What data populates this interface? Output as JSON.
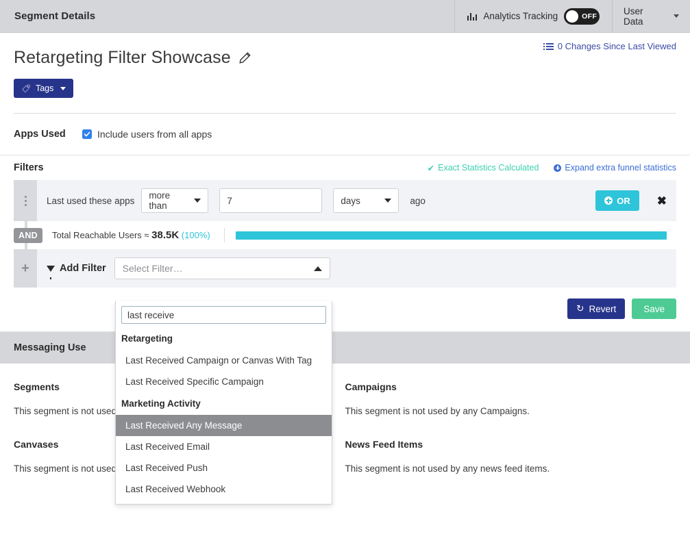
{
  "topbar": {
    "title": "Segment Details",
    "analytics_label": "Analytics Tracking",
    "toggle_state": "OFF",
    "user_data_label": "User Data"
  },
  "title_block": {
    "page_title": "Retargeting Filter Showcase",
    "changes_link": "0 Changes Since Last Viewed",
    "tags_button": "Tags"
  },
  "apps": {
    "label": "Apps Used",
    "checkbox_label": "Include users from all apps",
    "checked": true
  },
  "filters": {
    "title": "Filters",
    "exact_stats": "Exact Statistics Calculated",
    "expand_link": "Expand extra funnel statistics",
    "row": {
      "label": "Last used these apps",
      "operator": "more than",
      "value": "7",
      "unit": "days",
      "suffix": "ago",
      "or_button": "OR",
      "remove": "✖"
    },
    "connector": "AND",
    "stats": {
      "text_prefix": "Total Reachable Users ≈ ",
      "count": "38.5K",
      "percent": "(100%)",
      "bar_fill_percent": 100
    },
    "add_filter": {
      "label": "Add Filter",
      "select_placeholder": "Select Filter…"
    }
  },
  "dropdown": {
    "search_value": "last receive",
    "groups": [
      {
        "name": "Retargeting",
        "items": [
          {
            "label": "Last Received Campaign or Canvas With Tag",
            "highlighted": false
          },
          {
            "label": "Last Received Specific Campaign",
            "highlighted": false
          }
        ]
      },
      {
        "name": "Marketing Activity",
        "items": [
          {
            "label": "Last Received Any Message",
            "highlighted": true
          },
          {
            "label": "Last Received Email",
            "highlighted": false
          },
          {
            "label": "Last Received Push",
            "highlighted": false
          },
          {
            "label": "Last Received Webhook",
            "highlighted": false
          }
        ]
      }
    ]
  },
  "actions": {
    "revert": "Revert",
    "save": "Save"
  },
  "messaging_use": {
    "heading": "Messaging Use",
    "cells": [
      {
        "title": "Segments",
        "text": "This segment is not used by any Segments."
      },
      {
        "title": "Campaigns",
        "text": "This segment is not used by any Campaigns."
      },
      {
        "title": "Canvases",
        "text": "This segment is not used by any Canvases."
      },
      {
        "title": "News Feed Items",
        "text": "This segment is not used by any news feed items."
      }
    ]
  },
  "colors": {
    "navy": "#27348b",
    "teal": "#2ec4d9",
    "green": "#4ecb94",
    "blue_link": "#3b6ed8",
    "checkbox_blue": "#2f80ed",
    "mint": "#3ecfb2"
  }
}
